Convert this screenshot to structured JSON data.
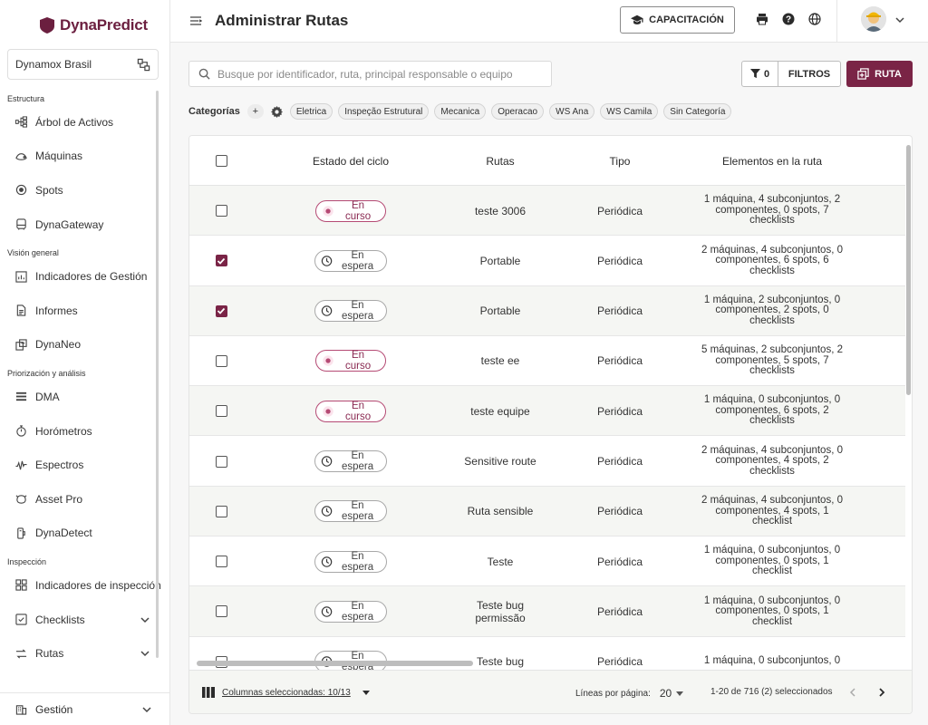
{
  "app": {
    "brand": "DynaPredict",
    "page_title": "Administrar Rutas"
  },
  "sidebar": {
    "company": "Dynamox Brasil",
    "sections": [
      {
        "title": "Estructura",
        "items": [
          {
            "label": "Árbol de Activos",
            "icon": "asset-tree-icon"
          },
          {
            "label": "Máquinas",
            "icon": "machine-icon"
          },
          {
            "label": "Spots",
            "icon": "spot-icon"
          },
          {
            "label": "DynaGateway",
            "icon": "gateway-icon"
          }
        ]
      },
      {
        "title": "Visión general",
        "items": [
          {
            "label": "Indicadores de Gestión",
            "icon": "chart-icon"
          },
          {
            "label": "Informes",
            "icon": "document-icon"
          },
          {
            "label": "DynaNeo",
            "icon": "dynaneo-icon"
          }
        ]
      },
      {
        "title": "Priorización y análisis",
        "items": [
          {
            "label": "DMA",
            "icon": "list-icon"
          },
          {
            "label": "Horómetros",
            "icon": "stopwatch-icon"
          },
          {
            "label": "Espectros",
            "icon": "spectrum-icon"
          },
          {
            "label": "Asset Pro",
            "icon": "asset-pro-icon"
          },
          {
            "label": "DynaDetect",
            "icon": "dynadetect-icon"
          }
        ]
      },
      {
        "title": "Inspección",
        "items": [
          {
            "label": "Indicadores de inspección",
            "icon": "grid-icon"
          },
          {
            "label": "Checklists",
            "icon": "checklist-icon",
            "expandable": true
          },
          {
            "label": "Rutas",
            "icon": "routes-icon",
            "expandable": true
          }
        ]
      }
    ],
    "bottom": {
      "label": "Gestión",
      "icon": "building-icon"
    }
  },
  "header": {
    "training_label": "CAPACITACIÓN"
  },
  "toolbar": {
    "search_placeholder": "Busque por identificador, ruta, principal responsable o equipo",
    "filter_count": "0",
    "filters_label": "FILTROS",
    "add_route_label": "RUTA"
  },
  "categories": {
    "label": "Categorías",
    "add": "+",
    "chips": [
      "Eletrica",
      "Inspeção Estrutural",
      "Mecanica",
      "Operacao",
      "WS Ana",
      "WS Camila",
      "Sin Categoría"
    ]
  },
  "table": {
    "columns": [
      "Estado del ciclo",
      "Rutas",
      "Tipo",
      "Elementos en la ruta"
    ],
    "rows": [
      {
        "checked": false,
        "status": "En curso",
        "status_type": "curso",
        "route": "teste 3006",
        "type": "Periódica",
        "elements": "1 máquina, 4 subconjuntos, 2 componentes, 0 spots, 7 checklists"
      },
      {
        "checked": true,
        "status": "En espera",
        "status_type": "espera",
        "route": "Portable",
        "type": "Periódica",
        "elements": "2 máquinas, 4 subconjuntos, 0 componentes, 6 spots, 6 checklists"
      },
      {
        "checked": true,
        "status": "En espera",
        "status_type": "espera",
        "route": "Portable",
        "type": "Periódica",
        "elements": "1 máquina, 2 subconjuntos, 0 componentes, 2 spots, 0 checklists"
      },
      {
        "checked": false,
        "status": "En curso",
        "status_type": "curso",
        "route": "teste ee",
        "type": "Periódica",
        "elements": "5 máquinas, 2 subconjuntos, 2 componentes, 5 spots, 7 checklists"
      },
      {
        "checked": false,
        "status": "En curso",
        "status_type": "curso",
        "route": "teste equipe",
        "type": "Periódica",
        "elements": "1 máquina, 0 subconjuntos, 0 componentes, 6 spots, 2 checklists"
      },
      {
        "checked": false,
        "status": "En espera",
        "status_type": "espera",
        "route": "Sensitive route",
        "type": "Periódica",
        "elements": "2 máquinas, 4 subconjuntos, 0 componentes, 4 spots, 2 checklists"
      },
      {
        "checked": false,
        "status": "En espera",
        "status_type": "espera",
        "route": "Ruta sensible",
        "type": "Periódica",
        "elements": "2 máquinas, 4 subconjuntos, 0 componentes, 4 spots, 1 checklist"
      },
      {
        "checked": false,
        "status": "En espera",
        "status_type": "espera",
        "route": "Teste",
        "type": "Periódica",
        "elements": "1 máquina, 0 subconjuntos, 0 componentes, 0 spots, 1 checklist"
      },
      {
        "checked": false,
        "status": "En espera",
        "status_type": "espera",
        "route": "Teste bug permissão",
        "type": "Periódica",
        "elements": "1 máquina, 0 subconjuntos, 0 componentes, 0 spots, 1 checklist"
      },
      {
        "checked": false,
        "status": "En espera",
        "status_type": "espera",
        "route": "Teste bug",
        "type": "Periódica",
        "elements": "1 máquina, 0 subconjuntos, 0"
      }
    ]
  },
  "footer": {
    "columns_selected": "Columnas seleccionadas: 10/13",
    "rows_per_page_label": "Líneas por página:",
    "rows_per_page": "20",
    "range": "1-20 de 716 (2) seleccionados"
  },
  "colors": {
    "brand": "#7a2446",
    "curso": "#b54a74"
  }
}
